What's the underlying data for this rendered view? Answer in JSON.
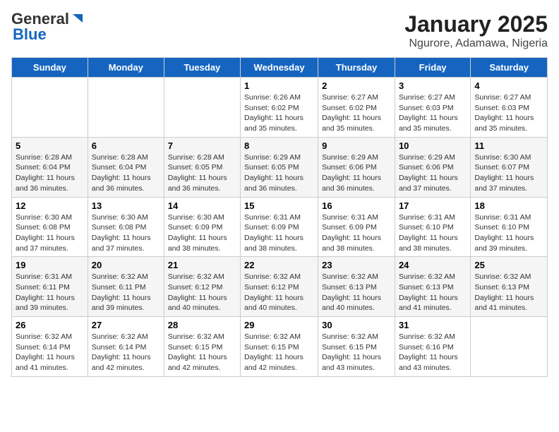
{
  "header": {
    "logo_general": "General",
    "logo_blue": "Blue",
    "month_title": "January 2025",
    "location": "Ngurore, Adamawa, Nigeria"
  },
  "weekdays": [
    "Sunday",
    "Monday",
    "Tuesday",
    "Wednesday",
    "Thursday",
    "Friday",
    "Saturday"
  ],
  "weeks": [
    [
      {
        "day": "",
        "info": ""
      },
      {
        "day": "",
        "info": ""
      },
      {
        "day": "",
        "info": ""
      },
      {
        "day": "1",
        "info": "Sunrise: 6:26 AM\nSunset: 6:02 PM\nDaylight: 11 hours and 35 minutes."
      },
      {
        "day": "2",
        "info": "Sunrise: 6:27 AM\nSunset: 6:02 PM\nDaylight: 11 hours and 35 minutes."
      },
      {
        "day": "3",
        "info": "Sunrise: 6:27 AM\nSunset: 6:03 PM\nDaylight: 11 hours and 35 minutes."
      },
      {
        "day": "4",
        "info": "Sunrise: 6:27 AM\nSunset: 6:03 PM\nDaylight: 11 hours and 35 minutes."
      }
    ],
    [
      {
        "day": "5",
        "info": "Sunrise: 6:28 AM\nSunset: 6:04 PM\nDaylight: 11 hours and 36 minutes."
      },
      {
        "day": "6",
        "info": "Sunrise: 6:28 AM\nSunset: 6:04 PM\nDaylight: 11 hours and 36 minutes."
      },
      {
        "day": "7",
        "info": "Sunrise: 6:28 AM\nSunset: 6:05 PM\nDaylight: 11 hours and 36 minutes."
      },
      {
        "day": "8",
        "info": "Sunrise: 6:29 AM\nSunset: 6:05 PM\nDaylight: 11 hours and 36 minutes."
      },
      {
        "day": "9",
        "info": "Sunrise: 6:29 AM\nSunset: 6:06 PM\nDaylight: 11 hours and 36 minutes."
      },
      {
        "day": "10",
        "info": "Sunrise: 6:29 AM\nSunset: 6:06 PM\nDaylight: 11 hours and 37 minutes."
      },
      {
        "day": "11",
        "info": "Sunrise: 6:30 AM\nSunset: 6:07 PM\nDaylight: 11 hours and 37 minutes."
      }
    ],
    [
      {
        "day": "12",
        "info": "Sunrise: 6:30 AM\nSunset: 6:08 PM\nDaylight: 11 hours and 37 minutes."
      },
      {
        "day": "13",
        "info": "Sunrise: 6:30 AM\nSunset: 6:08 PM\nDaylight: 11 hours and 37 minutes."
      },
      {
        "day": "14",
        "info": "Sunrise: 6:30 AM\nSunset: 6:09 PM\nDaylight: 11 hours and 38 minutes."
      },
      {
        "day": "15",
        "info": "Sunrise: 6:31 AM\nSunset: 6:09 PM\nDaylight: 11 hours and 38 minutes."
      },
      {
        "day": "16",
        "info": "Sunrise: 6:31 AM\nSunset: 6:09 PM\nDaylight: 11 hours and 38 minutes."
      },
      {
        "day": "17",
        "info": "Sunrise: 6:31 AM\nSunset: 6:10 PM\nDaylight: 11 hours and 38 minutes."
      },
      {
        "day": "18",
        "info": "Sunrise: 6:31 AM\nSunset: 6:10 PM\nDaylight: 11 hours and 39 minutes."
      }
    ],
    [
      {
        "day": "19",
        "info": "Sunrise: 6:31 AM\nSunset: 6:11 PM\nDaylight: 11 hours and 39 minutes."
      },
      {
        "day": "20",
        "info": "Sunrise: 6:32 AM\nSunset: 6:11 PM\nDaylight: 11 hours and 39 minutes."
      },
      {
        "day": "21",
        "info": "Sunrise: 6:32 AM\nSunset: 6:12 PM\nDaylight: 11 hours and 40 minutes."
      },
      {
        "day": "22",
        "info": "Sunrise: 6:32 AM\nSunset: 6:12 PM\nDaylight: 11 hours and 40 minutes."
      },
      {
        "day": "23",
        "info": "Sunrise: 6:32 AM\nSunset: 6:13 PM\nDaylight: 11 hours and 40 minutes."
      },
      {
        "day": "24",
        "info": "Sunrise: 6:32 AM\nSunset: 6:13 PM\nDaylight: 11 hours and 41 minutes."
      },
      {
        "day": "25",
        "info": "Sunrise: 6:32 AM\nSunset: 6:13 PM\nDaylight: 11 hours and 41 minutes."
      }
    ],
    [
      {
        "day": "26",
        "info": "Sunrise: 6:32 AM\nSunset: 6:14 PM\nDaylight: 11 hours and 41 minutes."
      },
      {
        "day": "27",
        "info": "Sunrise: 6:32 AM\nSunset: 6:14 PM\nDaylight: 11 hours and 42 minutes."
      },
      {
        "day": "28",
        "info": "Sunrise: 6:32 AM\nSunset: 6:15 PM\nDaylight: 11 hours and 42 minutes."
      },
      {
        "day": "29",
        "info": "Sunrise: 6:32 AM\nSunset: 6:15 PM\nDaylight: 11 hours and 42 minutes."
      },
      {
        "day": "30",
        "info": "Sunrise: 6:32 AM\nSunset: 6:15 PM\nDaylight: 11 hours and 43 minutes."
      },
      {
        "day": "31",
        "info": "Sunrise: 6:32 AM\nSunset: 6:16 PM\nDaylight: 11 hours and 43 minutes."
      },
      {
        "day": "",
        "info": ""
      }
    ]
  ]
}
